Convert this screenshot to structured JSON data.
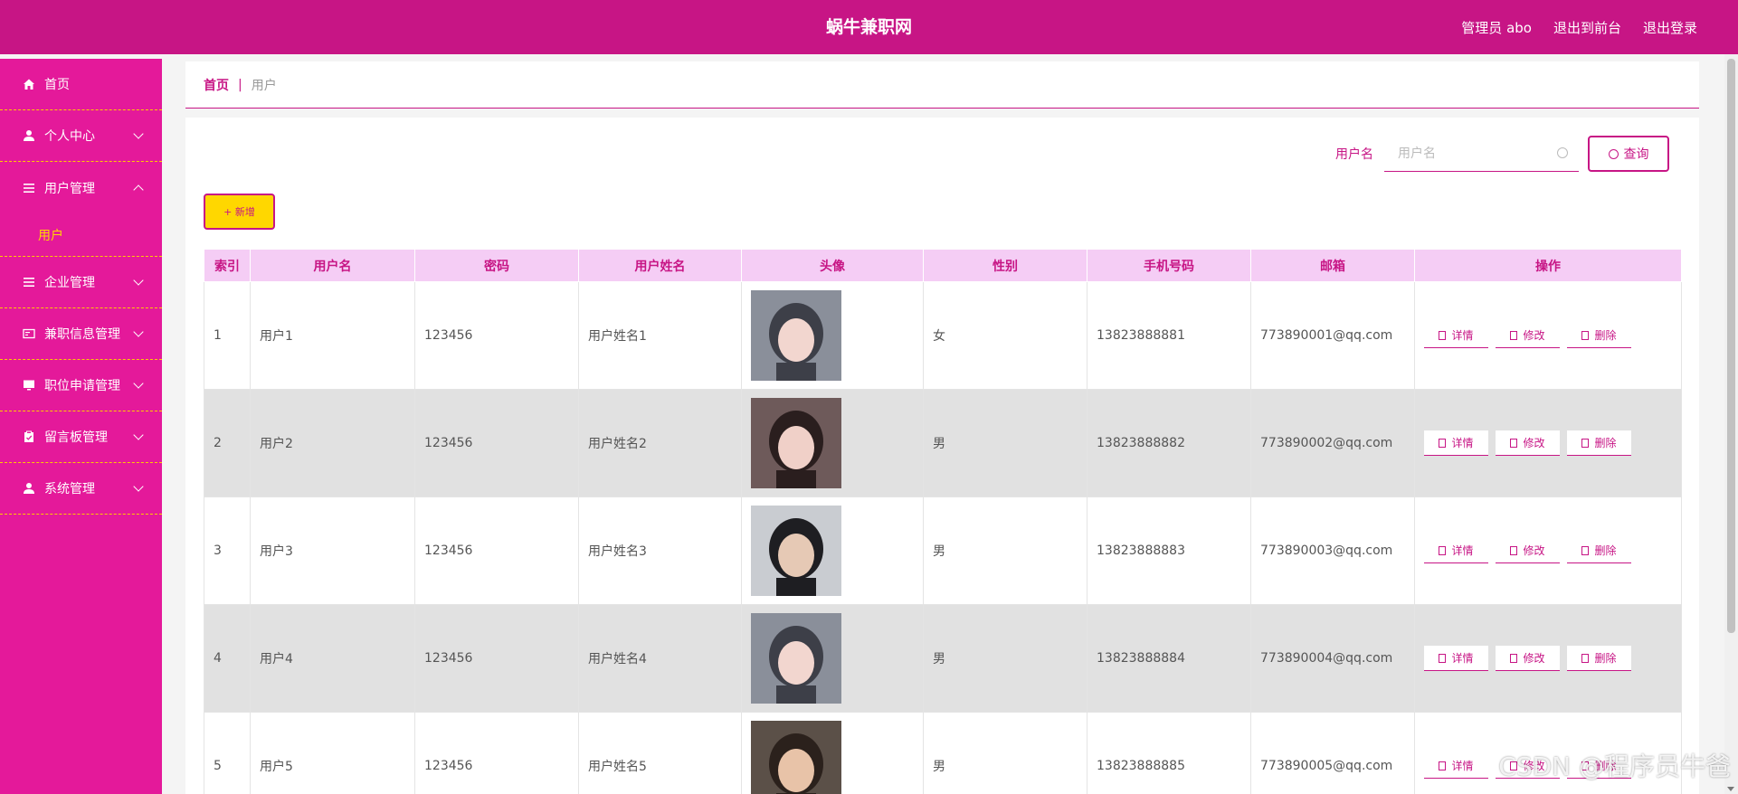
{
  "header": {
    "title": "蜗牛兼职网",
    "admin_label": "管理员 abo",
    "exit_front_label": "退出到前台",
    "logout_label": "退出登录"
  },
  "colors": {
    "primary": "#c71585",
    "sidebar": "#e4199a",
    "accent": "#ffd700",
    "table_header": "#f5cdf5"
  },
  "sidebar": {
    "items": [
      {
        "label": "首页",
        "icon": "home-icon"
      },
      {
        "label": "个人中心",
        "icon": "user-icon"
      },
      {
        "label": "用户管理",
        "icon": "list-icon",
        "submenu": "用户"
      },
      {
        "label": "企业管理",
        "icon": "list-icon"
      },
      {
        "label": "兼职信息管理",
        "icon": "card-icon"
      },
      {
        "label": "职位申请管理",
        "icon": "monitor-icon"
      },
      {
        "label": "留言板管理",
        "icon": "clipboard-icon"
      },
      {
        "label": "系统管理",
        "icon": "user-icon"
      }
    ]
  },
  "breadcrumb": {
    "home": "首页",
    "current": "用户"
  },
  "search": {
    "label": "用户名",
    "placeholder": "用户名",
    "button": "查询"
  },
  "add_button": "+ 新增",
  "table": {
    "headers": [
      "索引",
      "用户名",
      "密码",
      "用户姓名",
      "头像",
      "性别",
      "手机号码",
      "邮箱",
      "操作"
    ],
    "rows": [
      {
        "index": "1",
        "username": "用户1",
        "password": "123456",
        "name": "用户姓名1",
        "gender": "女",
        "phone": "13823888881",
        "email": "773890001@qq.com"
      },
      {
        "index": "2",
        "username": "用户2",
        "password": "123456",
        "name": "用户姓名2",
        "gender": "男",
        "phone": "13823888882",
        "email": "773890002@qq.com"
      },
      {
        "index": "3",
        "username": "用户3",
        "password": "123456",
        "name": "用户姓名3",
        "gender": "男",
        "phone": "13823888883",
        "email": "773890003@qq.com"
      },
      {
        "index": "4",
        "username": "用户4",
        "password": "123456",
        "name": "用户姓名4",
        "gender": "男",
        "phone": "13823888884",
        "email": "773890004@qq.com"
      },
      {
        "index": "5",
        "username": "用户5",
        "password": "123456",
        "name": "用户姓名5",
        "gender": "男",
        "phone": "13823888885",
        "email": "773890005@qq.com"
      }
    ],
    "actions": {
      "detail": "详情",
      "edit": "修改",
      "delete": "删除"
    }
  },
  "watermark": "CSDN @程序员牛爸"
}
